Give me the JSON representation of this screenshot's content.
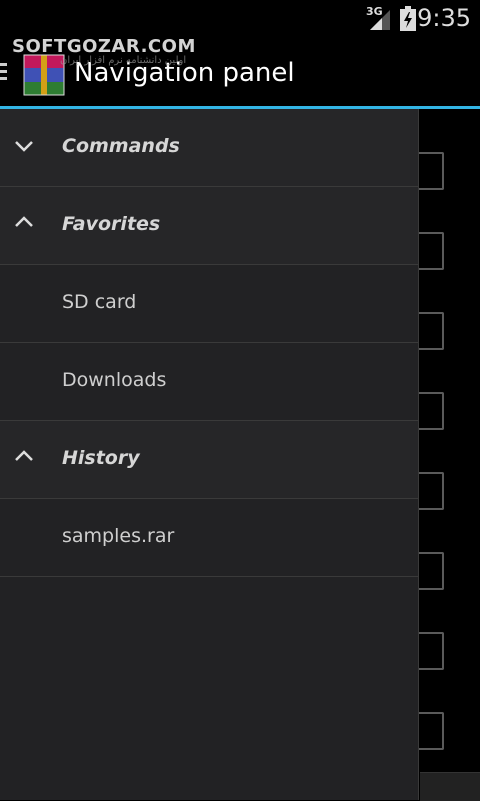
{
  "status_bar": {
    "network": "3G",
    "time": "9:35"
  },
  "watermark": {
    "text": "SOFTGOZAR.COM",
    "subtext": "اولین دانشنامه نرم افزار ایران"
  },
  "action_bar": {
    "title": "Navigation panel",
    "accent_color": "#33b5e5"
  },
  "drawer": {
    "sections": [
      {
        "label": "Commands",
        "expanded": false,
        "items": []
      },
      {
        "label": "Favorites",
        "expanded": true,
        "items": [
          {
            "label": "SD card"
          },
          {
            "label": "Downloads"
          }
        ]
      },
      {
        "label": "History",
        "expanded": true,
        "items": [
          {
            "label": "samples.rar"
          }
        ]
      }
    ]
  }
}
